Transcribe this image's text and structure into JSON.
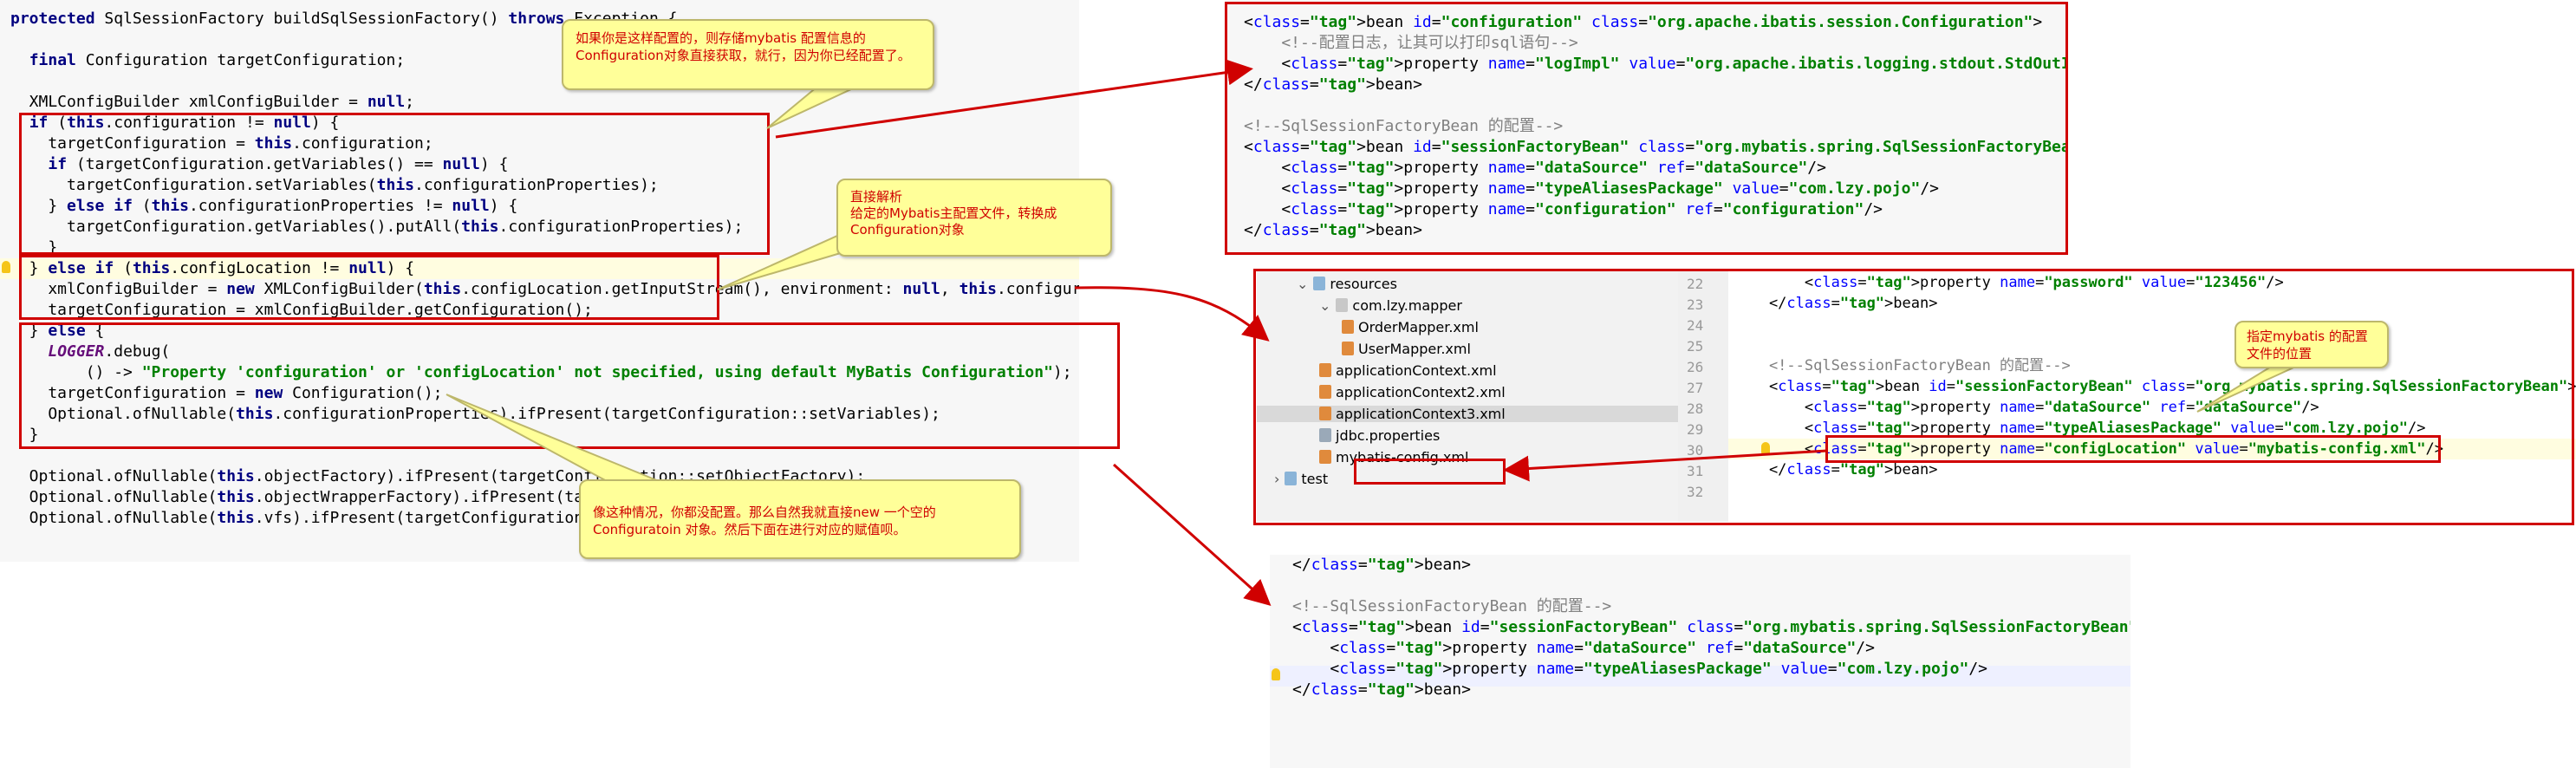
{
  "left_code": {
    "lines": [
      "protected SqlSessionFactory buildSqlSessionFactory() throws Exception {",
      "",
      "  final Configuration targetConfiguration;",
      "",
      "  XMLConfigBuilder xmlConfigBuilder = null;",
      "  if (this.configuration != null) {",
      "    targetConfiguration = this.configuration;",
      "    if (targetConfiguration.getVariables() == null) {",
      "      targetConfiguration.setVariables(this.configurationProperties);",
      "    } else if (this.configurationProperties != null) {",
      "      targetConfiguration.getVariables().putAll(this.configurationProperties);",
      "    }",
      "  } else if (this.configLocation != null) {",
      "    xmlConfigBuilder = new XMLConfigBuilder(this.configLocation.getInputStream(), environment: null, this.configurationProperties);",
      "    targetConfiguration = xmlConfigBuilder.getConfiguration();",
      "  } else {",
      "    LOGGER.debug(",
      "        () -> \"Property 'configuration' or 'configLocation' not specified, using default MyBatis Configuration\");",
      "    targetConfiguration = new Configuration();",
      "    Optional.ofNullable(this.configurationProperties).ifPresent(targetConfiguration::setVariables);",
      "  }",
      "",
      "  Optional.ofNullable(this.objectFactory).ifPresent(targetConfiguration::setObjectFactory);",
      "  Optional.ofNullable(this.objectWrapperFactory).ifPresent(targetConfiguration::setObjectWrapperFactory);",
      "  Optional.ofNullable(this.vfs).ifPresent(targetConfiguration::setVfsImpl);"
    ]
  },
  "callouts": {
    "c1": "如果你是这样配置的，则存储mybatis 配置信息的Configuration对象直接获取，就行，因为你已经配置了。",
    "c2_title": "直接解析",
    "c2_body": "给定的Mybatis主配置文件，转换成Configuration对象",
    "c3": "像这种情况，你都没配置。那么自然我就直接new 一个空的Configuratoin 对象。然后下面在进行对应的赋值呗。",
    "c4": "指定mybatis 的配置文件的位置"
  },
  "xml_top": {
    "lines": [
      "<bean id=\"configuration\" class=\"org.apache.ibatis.session.Configuration\">",
      "    <!--配置日志，让其可以打印sql语句-->",
      "    <property name=\"logImpl\" value=\"org.apache.ibatis.logging.stdout.StdOutImpl\"/>",
      "</bean>",
      "",
      "<!--SqlSessionFactoryBean 的配置-->",
      "<bean id=\"sessionFactoryBean\" class=\"org.mybatis.spring.SqlSessionFactoryBean\">",
      "    <property name=\"dataSource\" ref=\"dataSource\"/>",
      "    <property name=\"typeAliasesPackage\" value=\"com.lzy.pojo\"/>",
      "    <property name=\"configuration\" ref=\"configuration\"/>",
      "</bean>"
    ]
  },
  "project_tree": {
    "items": [
      {
        "label": "resources",
        "indent": 1,
        "type": "folder"
      },
      {
        "label": "com.lzy.mapper",
        "indent": 2,
        "type": "package"
      },
      {
        "label": "OrderMapper.xml",
        "indent": 3,
        "type": "xml"
      },
      {
        "label": "UserMapper.xml",
        "indent": 3,
        "type": "xml"
      },
      {
        "label": "applicationContext.xml",
        "indent": 2,
        "type": "xml"
      },
      {
        "label": "applicationContext2.xml",
        "indent": 2,
        "type": "xml"
      },
      {
        "label": "applicationContext3.xml",
        "indent": 2,
        "type": "xml"
      },
      {
        "label": "jdbc.properties",
        "indent": 2,
        "type": "props"
      },
      {
        "label": "mybatis-config.xml",
        "indent": 2,
        "type": "xml"
      },
      {
        "label": "test",
        "indent": 0,
        "type": "folder"
      }
    ]
  },
  "xml_mid": {
    "line_numbers": [
      "22",
      "23",
      "24",
      "25",
      "26",
      "27",
      "28",
      "29",
      "30",
      "31",
      "32"
    ],
    "lines": [
      "        <property name=\"password\" value=\"123456\"/>",
      "    </bean>",
      "",
      "",
      "    <!--SqlSessionFactoryBean 的配置-->",
      "    <bean id=\"sessionFactoryBean\" class=\"org.mybatis.spring.SqlSessionFactoryBean\">",
      "        <property name=\"dataSource\" ref=\"dataSource\"/>",
      "        <property name=\"typeAliasesPackage\" value=\"com.lzy.pojo\"/>",
      "        <property name=\"configLocation\" value=\"mybatis-config.xml\"/>",
      "    </bean>",
      ""
    ]
  },
  "xml_bottom": {
    "lines": [
      "</bean>",
      "",
      "<!--SqlSessionFactoryBean 的配置-->",
      "<bean id=\"sessionFactoryBean\" class=\"org.mybatis.spring.SqlSessionFactoryBean\">",
      "    <property name=\"dataSource\" ref=\"dataSource\"/>",
      "    <property name=\"typeAliasesPackage\" value=\"com.lzy.pojo\"/>",
      "</bean>"
    ]
  }
}
